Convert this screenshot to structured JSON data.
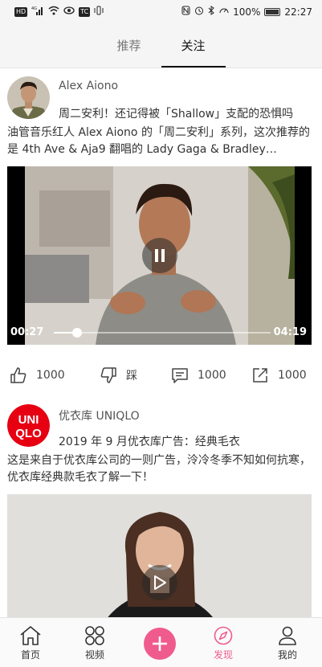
{
  "status_bar": {
    "left_icons": [
      "hd-icon",
      "signal-4g-icon",
      "wifi-icon",
      "eye-icon",
      "app-tc-icon",
      "vibrate-icon"
    ],
    "hd_label": "HD",
    "net_label": "4G",
    "app_label": "TC",
    "right_icons": [
      "nfc-icon",
      "alarm-icon",
      "bluetooth-icon",
      "speed-icon"
    ],
    "battery": "100%",
    "time": "22:27"
  },
  "tabs": [
    {
      "label": "推荐",
      "active": false
    },
    {
      "label": "关注",
      "active": true
    }
  ],
  "posts": [
    {
      "author": "Alex Aiono",
      "headline": "周二安利！还记得被「Shallow」支配的恐惧吗",
      "desc": "油管音乐红人 Alex Aiono 的「周二安利」系列，这次推荐的是 4th Ave & Aja9 翻唱的 Lady Gaga & Bradley…",
      "video": {
        "state": "playing",
        "control_icon": "pause-icon",
        "current_time": "00:27",
        "duration": "04:19",
        "progress": 0.107
      },
      "actions": {
        "like_count": "1000",
        "dislike_label": "踩",
        "comment_count": "1000",
        "share_count": "1000"
      }
    },
    {
      "author": "优衣库 UNIQLO",
      "avatar_logo": [
        "UNI",
        "QLO"
      ],
      "brand_color": "#e60012",
      "headline": "2019 年 9 月优衣库广告：经典毛衣",
      "desc": "这是来自于优衣库公司的一则广告，泠冷冬季不知如何抗寒，优衣库经典款毛衣了解一下！",
      "video": {
        "state": "paused",
        "control_icon": "play-icon"
      }
    }
  ],
  "bottom_nav": [
    {
      "label": "首页",
      "icon": "home-icon",
      "active": false
    },
    {
      "label": "视频",
      "icon": "video-grid-icon",
      "active": false
    },
    {
      "label": "",
      "icon": "add-icon",
      "active": false
    },
    {
      "label": "发现",
      "icon": "compass-icon",
      "active": true
    },
    {
      "label": "我的",
      "icon": "user-icon",
      "active": false
    }
  ],
  "colors": {
    "accent": "#f05b8e",
    "active_tab_underline": "#111111"
  }
}
